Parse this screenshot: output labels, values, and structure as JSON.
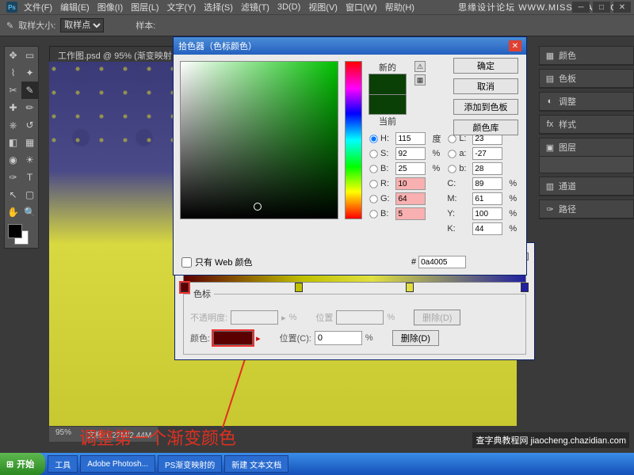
{
  "app": {
    "icon": "Ps"
  },
  "menu": [
    "文件(F)",
    "编辑(E)",
    "图像(I)",
    "图层(L)",
    "文字(Y)",
    "选择(S)",
    "滤镜(T)",
    "3D(D)",
    "视图(V)",
    "窗口(W)",
    "帮助(H)"
  ],
  "logo": "思缘设计论坛  WWW.MISSYUAN.COM",
  "options": {
    "sample_label": "取样大小:",
    "sample_value": "取样点",
    "style_label": "样本:"
  },
  "doc_tab": "工作图.psd @ 95% (渐变映射",
  "status": {
    "zoom": "95%",
    "doc": "文档:1.22M/2.44M"
  },
  "panels": {
    "color": "颜色",
    "swatch": "色板",
    "adjust": "调整",
    "styles": "样式",
    "layers": "图层",
    "channels": "通道",
    "paths": "路径"
  },
  "gradient": {
    "stops_legend": "色标",
    "opacity_label": "不透明度:",
    "pos_label": "位置",
    "delete_btn": "删除(D)",
    "color_label": "颜色:",
    "posc_label": "位置(C):",
    "posc_value": "0",
    "pct": "%"
  },
  "picker": {
    "title": "拾色器（色标颜色）",
    "new_label": "新的",
    "current_label": "当前",
    "ok": "确定",
    "cancel": "取消",
    "add": "添加到色板",
    "lib": "颜色库",
    "H": "115",
    "S": "92",
    "B": "25",
    "R": "10",
    "G": "64",
    "Bch": "5",
    "L": "23",
    "a": "-27",
    "bb": "28",
    "C": "89",
    "M": "61",
    "Y": "100",
    "K": "44",
    "deg": "度",
    "pct": "%",
    "hex": "0a4005",
    "web_only": "只有 Web 颜色"
  },
  "annotation": "调整第一个渐变颜色",
  "watermark": "查字典教程网\njiaocheng.chazidian.com",
  "taskbar": {
    "start": "开始",
    "items": [
      "工具",
      "Adobe Photosh...",
      "PS渐变映射的",
      "新建 文本文档"
    ]
  }
}
